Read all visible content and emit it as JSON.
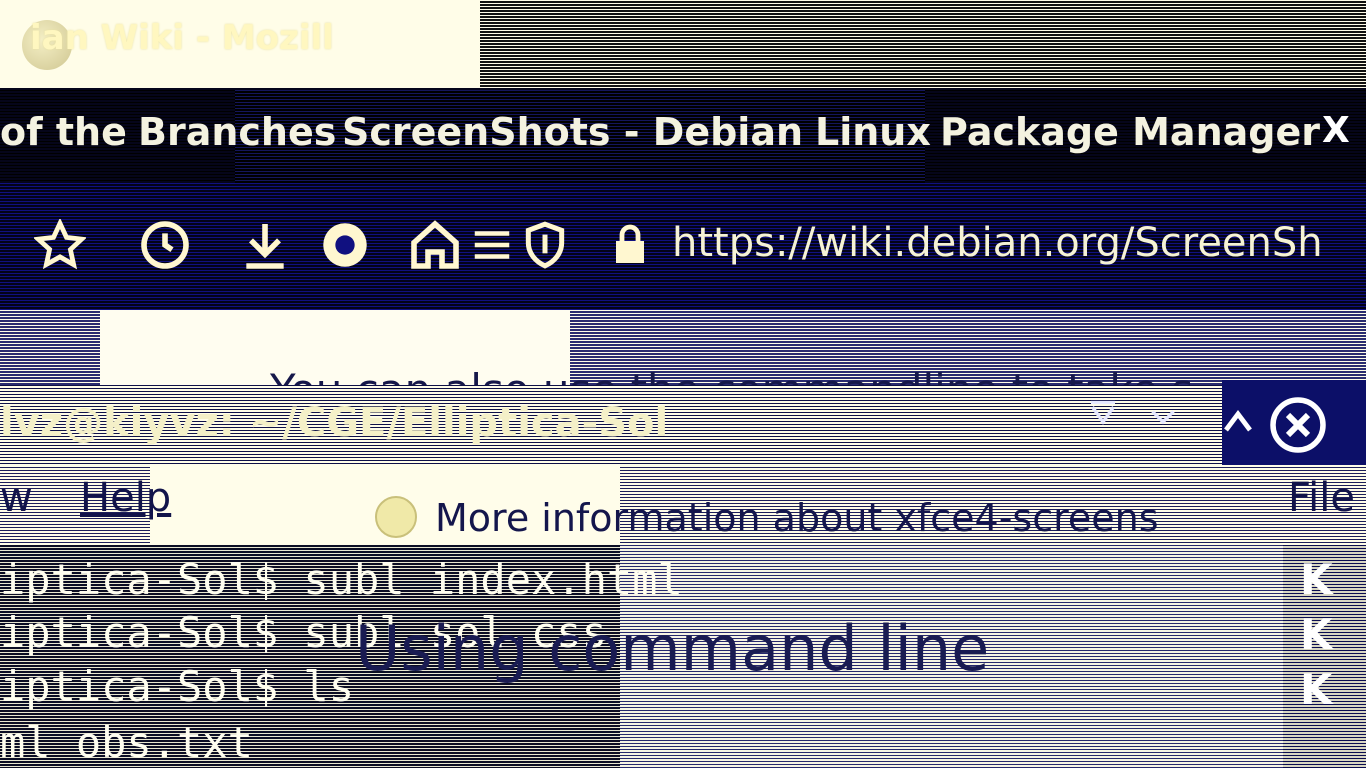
{
  "window": {
    "title": "ian Wiki - Mozill"
  },
  "tabs": [
    {
      "label": "of the"
    },
    {
      "label": "Branches"
    },
    {
      "label": "ScreenShots - Debian"
    },
    {
      "label": "Linux"
    },
    {
      "label": "Package Manager"
    }
  ],
  "tab_close": "X",
  "toolbar": {
    "icons": [
      "star-icon",
      "history-icon",
      "download-icon",
      "sync-icon",
      "home-icon",
      "menu-icon",
      "shield-icon",
      "lock-icon"
    ],
    "url": "https://wiki.debian.org/ScreenSh"
  },
  "page": {
    "line1": "You can also use the commandline to take s",
    "heading": "Using command line"
  },
  "terminal": {
    "title": "lvz@kiyvz: ~/CGE/Elliptica-Sol",
    "menu_view": "w",
    "menu_help": "Help",
    "info_text": "More information about xfce4-screens",
    "right_menu": "File",
    "lines": [
      "iptica-Sol$ subl index.html",
      "iptica-Sol$ subl sol.css",
      "iptica-Sol$ ls",
      "ml  obs.txt"
    ],
    "side_letters": [
      "K",
      "K",
      "K"
    ]
  }
}
